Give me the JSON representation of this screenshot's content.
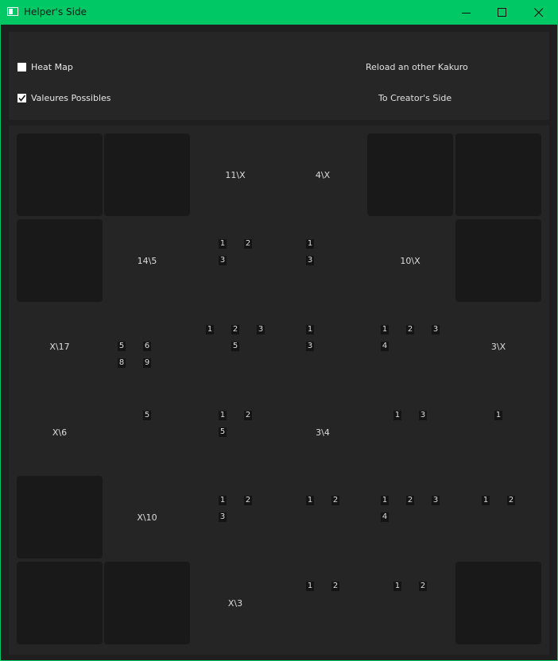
{
  "window": {
    "title": "Helper's Side",
    "icon": "app-window-icon",
    "controls": [
      "minimize-icon",
      "maximize-icon",
      "close-icon"
    ]
  },
  "options": {
    "heat_map": {
      "label": "Heat Map",
      "checked": false
    },
    "valeures": {
      "label": "Valeures Possibles",
      "checked": true
    }
  },
  "actions": {
    "reload": "Reload an other Kakuro",
    "creator": "To Creator's Side"
  },
  "grid": {
    "rows": [
      [
        {
          "type": "black"
        },
        {
          "type": "black"
        },
        {
          "type": "clue",
          "text": "11\\X"
        },
        {
          "type": "clue",
          "text": "4\\X"
        },
        {
          "type": "black"
        },
        {
          "type": "black"
        }
      ],
      [
        {
          "type": "black"
        },
        {
          "type": "clue",
          "text": "14\\5"
        },
        {
          "type": "cell",
          "candidates": [
            "1",
            "2",
            "3"
          ]
        },
        {
          "type": "cell",
          "candidates": [
            "1",
            "",
            "3"
          ]
        },
        {
          "type": "clue",
          "text": "10\\X"
        },
        {
          "type": "black"
        }
      ],
      [
        {
          "type": "clue",
          "text": "X\\17"
        },
        {
          "type": "cell",
          "candidates": [
            "",
            "",
            "",
            "5",
            "6",
            "",
            "8",
            "9",
            ""
          ]
        },
        {
          "type": "cell",
          "candidates": [
            "1",
            "2",
            "3",
            "",
            "5",
            ""
          ]
        },
        {
          "type": "cell",
          "candidates": [
            "1",
            "",
            "3"
          ]
        },
        {
          "type": "cell",
          "candidates": [
            "1",
            "2",
            "3",
            "4",
            "",
            ""
          ]
        },
        {
          "type": "clue",
          "text": "3\\X"
        }
      ],
      [
        {
          "type": "clue",
          "text": "X\\6"
        },
        {
          "type": "cell",
          "candidates": [
            "5"
          ]
        },
        {
          "type": "cell",
          "candidates": [
            "1",
            "2",
            "5",
            ""
          ]
        },
        {
          "type": "clue",
          "text": "3\\4"
        },
        {
          "type": "cell",
          "candidates": [
            "1",
            "3"
          ]
        },
        {
          "type": "cell",
          "candidates": [
            "1"
          ]
        }
      ],
      [
        {
          "type": "black"
        },
        {
          "type": "clue",
          "text": "X\\10"
        },
        {
          "type": "cell",
          "candidates": [
            "1",
            "2",
            "3"
          ]
        },
        {
          "type": "cell",
          "candidates": [
            "1",
            "2"
          ]
        },
        {
          "type": "cell",
          "candidates": [
            "1",
            "2",
            "3",
            "4",
            "",
            ""
          ]
        },
        {
          "type": "cell",
          "candidates": [
            "1",
            "2"
          ]
        }
      ],
      [
        {
          "type": "black"
        },
        {
          "type": "black"
        },
        {
          "type": "clue",
          "text": "X\\3"
        },
        {
          "type": "cell",
          "candidates": [
            "1",
            "2"
          ]
        },
        {
          "type": "cell",
          "candidates": [
            "1",
            "2"
          ]
        },
        {
          "type": "black"
        }
      ]
    ]
  }
}
